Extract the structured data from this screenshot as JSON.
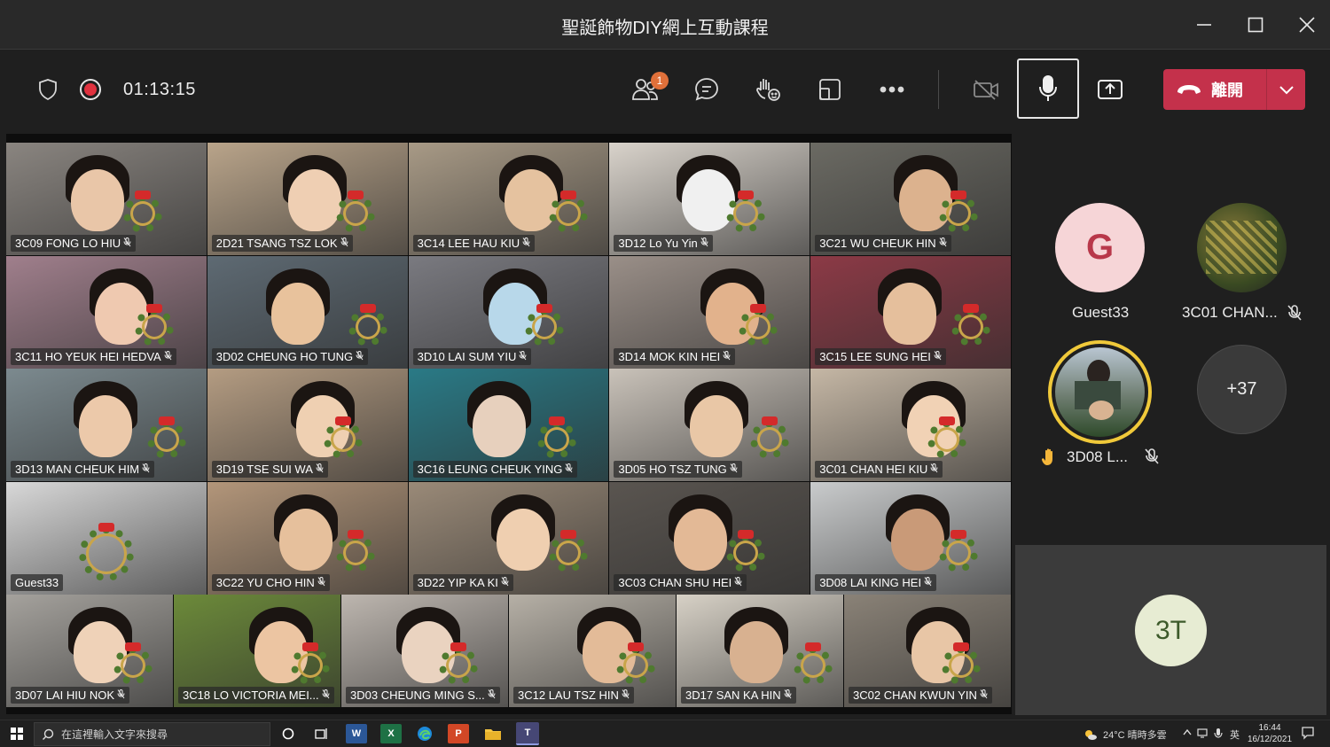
{
  "window": {
    "title": "聖誕飾物DIY網上互動課程",
    "minimize": "minimize",
    "maximize": "maximize",
    "close": "close"
  },
  "toolbar": {
    "timer": "01:13:15",
    "people_badge": "1",
    "leave_label": "離開",
    "accent_leave": "#c4314b",
    "icons": [
      "shield-icon",
      "record-icon",
      "people-icon",
      "chat-icon",
      "raise-hand-icon",
      "rooms-icon",
      "more-icon",
      "camera-off-icon",
      "mic-icon",
      "share-icon",
      "phone-hangup-icon",
      "chevron-down-icon"
    ]
  },
  "grid": {
    "rows": [
      [
        {
          "name": "3C09 FONG LO HIU",
          "bg": "#8a8580",
          "face": "#e9c6a8"
        },
        {
          "name": "2D21 TSANG TSZ LOK",
          "bg": "#b9a48a",
          "face": "#efcfb3"
        },
        {
          "name": "3C14 LEE HAU KIU",
          "bg": "#a89a86",
          "face": "#e5c29f"
        },
        {
          "name": "3D12 Lo Yu Yin",
          "bg": "#d9d3cb",
          "face": "#f0f0f0"
        },
        {
          "name": "3C21 WU CHEUK HIN",
          "bg": "#6b6a63",
          "face": "#dcb28e"
        }
      ],
      [
        {
          "name": "3C11 HO YEUK HEI HEDVA",
          "bg": "#a07f8c",
          "face": "#efc9b0"
        },
        {
          "name": "3D02 CHEUNG HO TUNG",
          "bg": "#5e6a73",
          "face": "#e8c29c"
        },
        {
          "name": "3D10 LAI SUM YIU",
          "bg": "#7a7a80",
          "face": "#b8d8ea"
        },
        {
          "name": "3D14 MOK KIN HEI",
          "bg": "#9a8f88",
          "face": "#e2b28c"
        },
        {
          "name": "3C15 LEE SUNG HEI",
          "bg": "#8c3a46",
          "face": "#e5bf9c"
        }
      ],
      [
        {
          "name": "3D13 MAN CHEUK HIM",
          "bg": "#7c8a8f",
          "face": "#ecc9aa"
        },
        {
          "name": "3D19 TSE SUI WA",
          "bg": "#b49c82",
          "face": "#efd0b2"
        },
        {
          "name": "3C16 LEUNG CHEUK YING",
          "bg": "#2a7a86",
          "face": "#e7d0bd"
        },
        {
          "name": "3D05 HO TSZ TUNG",
          "bg": "#c9c2b9",
          "face": "#e9c7a6"
        },
        {
          "name": "3C01 CHAN HEI KIU",
          "bg": "#c5b7a5",
          "face": "#f1d2b5"
        }
      ],
      [
        {
          "name": "Guest33",
          "bg": "#d8d8d8",
          "face": ""
        },
        {
          "name": "3C22 YU CHO HIN",
          "bg": "#b3967a",
          "face": "#e6c09c"
        },
        {
          "name": "3D22 YIP KA KI",
          "bg": "#9a8a78",
          "face": "#efcfb0"
        },
        {
          "name": "3C03 CHAN SHU HEI",
          "bg": "#5a5550",
          "face": "#e3b996"
        },
        {
          "name": "3D08 LAI KING HEI",
          "bg": "#c9cbcc",
          "face": "#c99a78"
        }
      ],
      [
        {
          "name": "3D07 LAI HIU NOK",
          "bg": "#a5a29d",
          "face": "#efd2b8"
        },
        {
          "name": "3C18 LO VICTORIA MEI...",
          "bg": "#6c8a3a",
          "face": "#ecc5a2"
        },
        {
          "name": "3D03 CHEUNG MING S...",
          "bg": "#bdb6af",
          "face": "#ead3c0"
        },
        {
          "name": "3C12 LAU TSZ HIN",
          "bg": "#b6b0a6",
          "face": "#e3bb98"
        },
        {
          "name": "3D17 SAN KA HIN",
          "bg": "#d7d1c6",
          "face": "#d8b190"
        },
        {
          "name": "3C02 CHAN KWUN YIN",
          "bg": "#8a8277",
          "face": "#e8c6a6"
        }
      ]
    ]
  },
  "side_panel": {
    "guest_initial": "G",
    "guest_name": "Guest33",
    "chan_name": "3C01 CHAN...",
    "speaker_name": "3D08 L...",
    "overflow_count": "+37",
    "self_initials": "3T"
  },
  "taskbar": {
    "search_placeholder": "在這裡輸入文字來搜尋",
    "weather": "24°C  晴時多雲",
    "ime": "英",
    "time": "16:44",
    "date": "16/12/2021"
  }
}
